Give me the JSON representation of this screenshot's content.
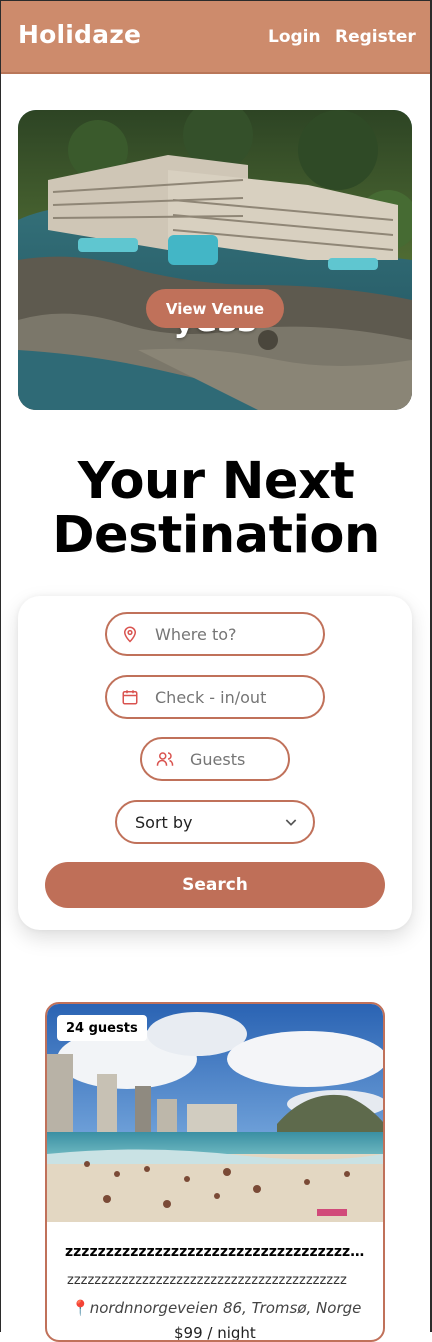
{
  "header": {
    "logo": "Holidaze",
    "login": "Login",
    "register": "Register"
  },
  "hero": {
    "title": "yess",
    "button": "View Venue"
  },
  "main": {
    "heading": "Your Next Destination"
  },
  "search": {
    "where_placeholder": "Where to?",
    "dates_placeholder": "Check - in/out",
    "guests_placeholder": "Guests",
    "sort_value": "Sort by",
    "submit": "Search"
  },
  "venue": {
    "guests_badge": "24 guests",
    "name": "zzzzzzzzzzzzzzzzzzzzzzzzzzzzzzzzzzzzzzzzzz",
    "description": "zzzzzzzzzzzzzzzzzzzzzzzzzzzzzzzzzzzzzzzzz",
    "address": "nordnnorgeveien 86, Tromsø, Norge",
    "price": "$99 / night"
  },
  "colors": {
    "header_bg": "#cd8b6c",
    "accent": "#c0715a",
    "white": "#ffffff"
  },
  "icons": [
    "location-pin-icon",
    "calendar-icon",
    "guests-icon",
    "chevron-down-icon",
    "map-pin-icon"
  ]
}
